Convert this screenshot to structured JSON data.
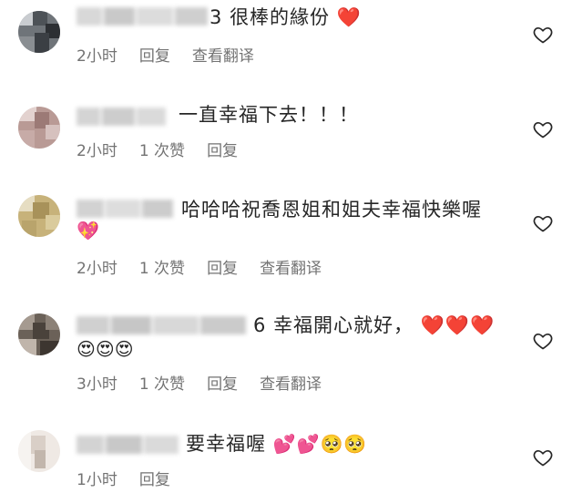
{
  "comments": [
    {
      "name_tail": "3",
      "text": "很棒的緣份",
      "emoji": "❤️",
      "time": "2小时",
      "likes": "",
      "reply": "回复",
      "translate": "查看翻译"
    },
    {
      "name_tail": "",
      "text": "一直幸福下去！！！",
      "emoji": "",
      "time": "2小时",
      "likes": "1 次赞",
      "reply": "回复",
      "translate": ""
    },
    {
      "name_tail": "",
      "text": "哈哈哈祝喬恩姐和姐夫幸福快樂喔",
      "emoji": "💖",
      "time": "2小时",
      "likes": "1 次赞",
      "reply": "回复",
      "translate": "查看翻译"
    },
    {
      "name_tail": "6",
      "text": "幸福開心就好，",
      "emoji": "❤️❤️❤️",
      "emoji2": "😍😍😍",
      "time": "3小时",
      "likes": "1 次赞",
      "reply": "回复",
      "translate": "查看翻译"
    },
    {
      "name_tail": "",
      "text": "要幸福喔",
      "emoji": "💕💕🥺🥺",
      "time": "1小时",
      "likes": "",
      "reply": "回复",
      "translate": ""
    }
  ],
  "colors": {
    "text": "#262626",
    "meta": "#737373",
    "heart_outline": "#262626",
    "red_heart": "#ed1f2a"
  }
}
